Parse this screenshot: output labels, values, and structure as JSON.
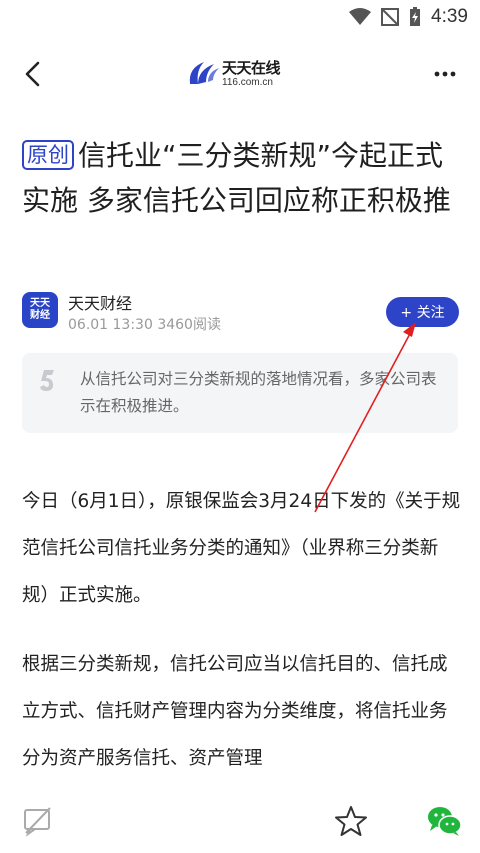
{
  "status_bar": {
    "time": "4:39"
  },
  "nav": {
    "logo_name": "天天在线",
    "logo_domain": "116.com.cn"
  },
  "article": {
    "badge": "原创",
    "title": "信托业“三分类新规”今起正式实施 多家信托公司回应称正积极推",
    "author": {
      "avatar_text": "天天财经",
      "name": "天天财经",
      "meta": "06.01 13:30  3460阅读"
    },
    "follow_label": "+ 关注",
    "summary": "从信托公司对三分类新规的落地情况看，多家公司表示在积极推进。",
    "paragraphs": [
      "今日（6月1日），原银保监会3月24日下发的《关于规范信托公司信托业务分类的通知》（业界称三分类新规）正式实施。",
      "根据三分类新规，信托公司应当以信托目的、信托成立方式、信托财产管理内容为分类维度，将信托业务分为资产服务信托、资产管理"
    ]
  },
  "colors": {
    "brand": "#2d44c8",
    "annotation": "#e02020"
  },
  "icons": {
    "back": "chevron-left-icon",
    "more": "more-dots-icon",
    "comment": "comment-off-icon",
    "favorite": "star-icon",
    "share": "wechat-icon"
  }
}
